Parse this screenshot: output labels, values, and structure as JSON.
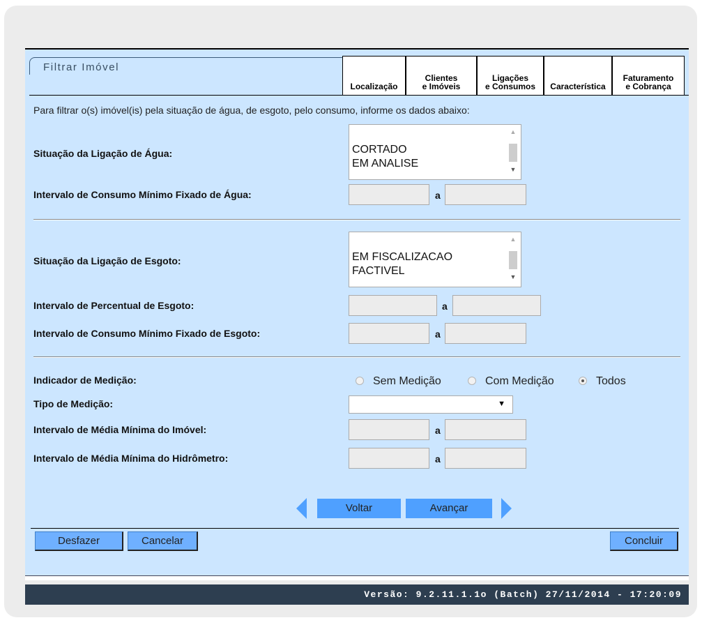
{
  "title": "Filtrar Imóvel",
  "tabs": [
    {
      "label_1": "",
      "label_2": "Localização"
    },
    {
      "label_1": "Clientes",
      "label_2": "e Imóveis"
    },
    {
      "label_1": "Ligações",
      "label_2": "e Consumos"
    },
    {
      "label_1": "",
      "label_2": "Característica"
    },
    {
      "label_1": "Faturamento",
      "label_2": "e Cobrança"
    }
  ],
  "intro": "Para filtrar o(s) imóvel(is) pela situação de água, de esgoto, pelo consumo, informe os dados abaixo:",
  "agua": {
    "situacao_label": "Situação da Ligação de Água:",
    "options": [
      "CORTADO",
      "EM ANALISE"
    ],
    "consumo_label": "Intervalo de Consumo Mínimo Fixado de Água:"
  },
  "esgoto": {
    "situacao_label": "Situação da Ligação de Esgoto:",
    "options": [
      "EM FISCALIZACAO",
      "FACTIVEL"
    ],
    "percentual_label": "Intervalo de Percentual de Esgoto:",
    "consumo_label": "Intervalo de Consumo Mínimo Fixado de Esgoto:"
  },
  "medicao": {
    "indicador_label": "Indicador de Medição:",
    "radios": [
      {
        "label": "Sem Medição",
        "checked": false
      },
      {
        "label": "Com Medição",
        "checked": false
      },
      {
        "label": "Todos",
        "checked": true
      }
    ],
    "tipo_label": "Tipo de Medição:",
    "tipo_value": "",
    "media_imovel_label": "Intervalo de Média Mínima do Imóvel:",
    "media_hidrometro_label": "Intervalo de Média Mínima do Hidrômetro:"
  },
  "range_separator": "a",
  "nav": {
    "back": "Voltar",
    "next": "Avançar"
  },
  "actions": {
    "undo": "Desfazer",
    "cancel": "Cancelar",
    "finish": "Concluir"
  },
  "footer": "Versão: 9.2.11.1.1o (Batch) 27/11/2014 - 17:20:09"
}
